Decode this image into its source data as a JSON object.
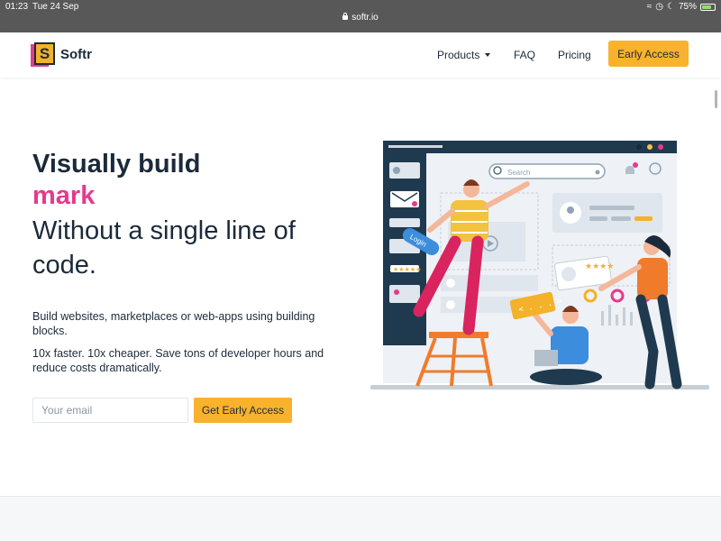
{
  "status": {
    "time": "01:23",
    "date": "Tue 24 Sep",
    "battery": "75%",
    "battery_level": 0.75,
    "url": "softr.io"
  },
  "nav": {
    "logo_letter": "S",
    "logo_text": "Softr",
    "products": "Products",
    "faq": "FAQ",
    "pricing": "Pricing",
    "cta": "Early Access"
  },
  "hero": {
    "line1": "Visually build",
    "line2": "mark",
    "line3": "Without a single line of code.",
    "p1": "Build websites, marketplaces or web-apps using building blocks.",
    "p2": "10x faster. 10x cheaper. Save tons of developer hours and reduce costs dramatically.",
    "email_placeholder": "Your email",
    "cta": "Get Early Access"
  },
  "illustration": {
    "search_text": "Search",
    "login_text": "Login",
    "code_text": "< . . . >",
    "notification_count": "1"
  },
  "colors": {
    "brand_yellow": "#f8b22b",
    "brand_pink": "#e63a8c",
    "text_dark": "#1b2a3b"
  }
}
